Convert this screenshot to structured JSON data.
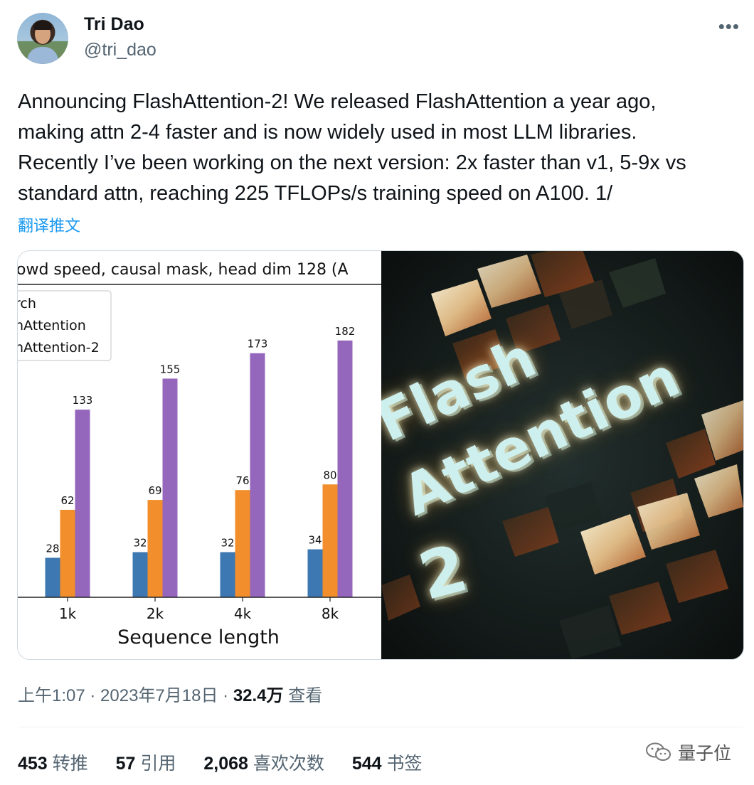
{
  "author": {
    "name": "Tri Dao",
    "handle": "@tri_dao"
  },
  "more_icon": "more-horizontal-icon",
  "tweet": {
    "lines": [
      "Announcing FlashAttention-2! We released FlashAttention a year ago,",
      "making attn 2-4 faster and is now widely used in most LLM libraries.",
      "Recently I’ve been working on the next version: 2x faster than v1, 5-9x vs",
      "standard attn, reaching 225 TFLOPs/s training speed on A100. 1/"
    ],
    "translate_label": "翻译推文"
  },
  "chart_data": {
    "type": "bar",
    "title": "owd speed, causal mask, head dim 128 (A",
    "xlabel": "Sequence length",
    "ylabel": "",
    "categories": [
      "1k",
      "2k",
      "4k",
      "8k"
    ],
    "series": [
      {
        "name": "rch",
        "color": "#3e78b2",
        "values": [
          28,
          32,
          32,
          34
        ]
      },
      {
        "name": "nAttention",
        "color": "#f28e2b",
        "values": [
          62,
          69,
          76,
          80
        ]
      },
      {
        "name": "nAttention-2",
        "color": "#9467bd",
        "values": [
          133,
          155,
          173,
          182
        ]
      }
    ],
    "ylim": [
      0,
      190
    ],
    "legend_position": "top-left",
    "grid": false
  },
  "art": {
    "lines": [
      "Flash",
      "Attention",
      "2"
    ]
  },
  "meta": {
    "time": "上午1:07",
    "sep1": " · ",
    "date": "2023年7月18日",
    "sep2": " · ",
    "views": "32.4万",
    "views_label": " 查看"
  },
  "stats": [
    {
      "value": "453",
      "label": " 转推"
    },
    {
      "value": "57",
      "label": " 引用"
    },
    {
      "value": "2,068",
      "label": " 喜欢次数"
    },
    {
      "value": "544",
      "label": " 书签"
    }
  ],
  "watermark": {
    "text": "量子位",
    "icon": "wechat-icon"
  }
}
